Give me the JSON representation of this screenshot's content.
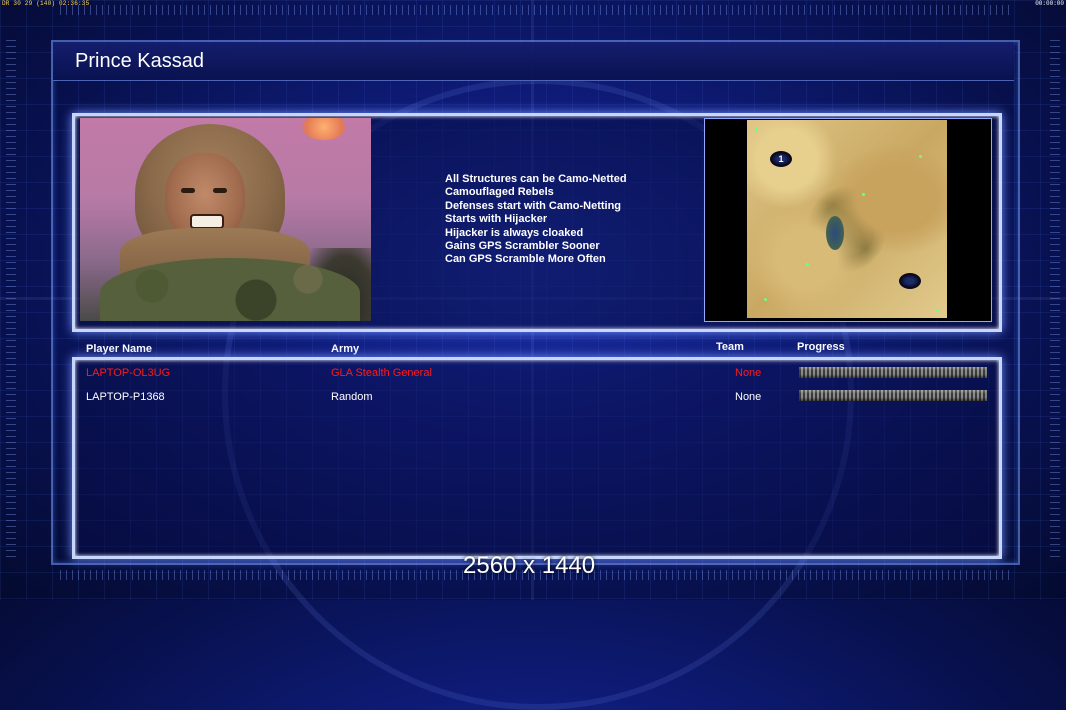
{
  "status": {
    "left": "DR 30 29 (140) 02:36:35",
    "right": "00:00:00"
  },
  "general": {
    "name": "Prince Kassad",
    "features": [
      "All Structures can be Camo-Netted",
      "Camouflaged Rebels",
      "Defenses start with Camo-Netting",
      "Starts with Hijacker",
      "Hijacker is always cloaked",
      "Gains GPS Scrambler Sooner",
      "Can GPS Scramble More Often"
    ]
  },
  "map": {
    "start_positions": [
      "1",
      ""
    ]
  },
  "players_table": {
    "headers": {
      "player_name": "Player Name",
      "army": "Army",
      "team": "Team",
      "progress": "Progress"
    },
    "rows": [
      {
        "name": "LAPTOP-OL3UG",
        "army": "GLA Stealth General",
        "team": "None",
        "progress": 0,
        "color": "#ff1a1a"
      },
      {
        "name": "LAPTOP-P1368",
        "army": "Random",
        "team": "None",
        "progress": 0,
        "color": "#ffffff"
      }
    ]
  },
  "resolution": "2560 x 1440",
  "colors": {
    "accent_border": "#c6d6ff",
    "local_player": "#ff1a1a"
  }
}
